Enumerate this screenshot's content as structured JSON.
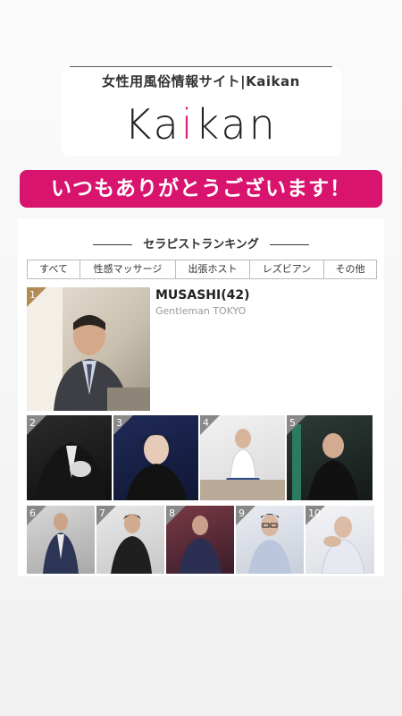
{
  "header": {
    "site_title": "女性用風俗情報サイト|Kaikan",
    "logo_pre": "Ka",
    "logo_accent": "i",
    "logo_post": "kan"
  },
  "banner": {
    "text": "いつもありがとうございます！"
  },
  "ranking": {
    "title": "セラピストランキング",
    "tabs": [
      "すべて",
      "性感マッサージ",
      "出張ホスト",
      "レズビアン",
      "その他"
    ],
    "top": {
      "rank": "1",
      "name": "MUSASHI(42)",
      "shop": "Gentleman TOKYO"
    },
    "row2": [
      "2",
      "3",
      "4",
      "5"
    ],
    "row3": [
      "6",
      "7",
      "8",
      "9",
      "10"
    ]
  },
  "colors": {
    "accent": "#d8146e",
    "gold": "#b48b55"
  }
}
